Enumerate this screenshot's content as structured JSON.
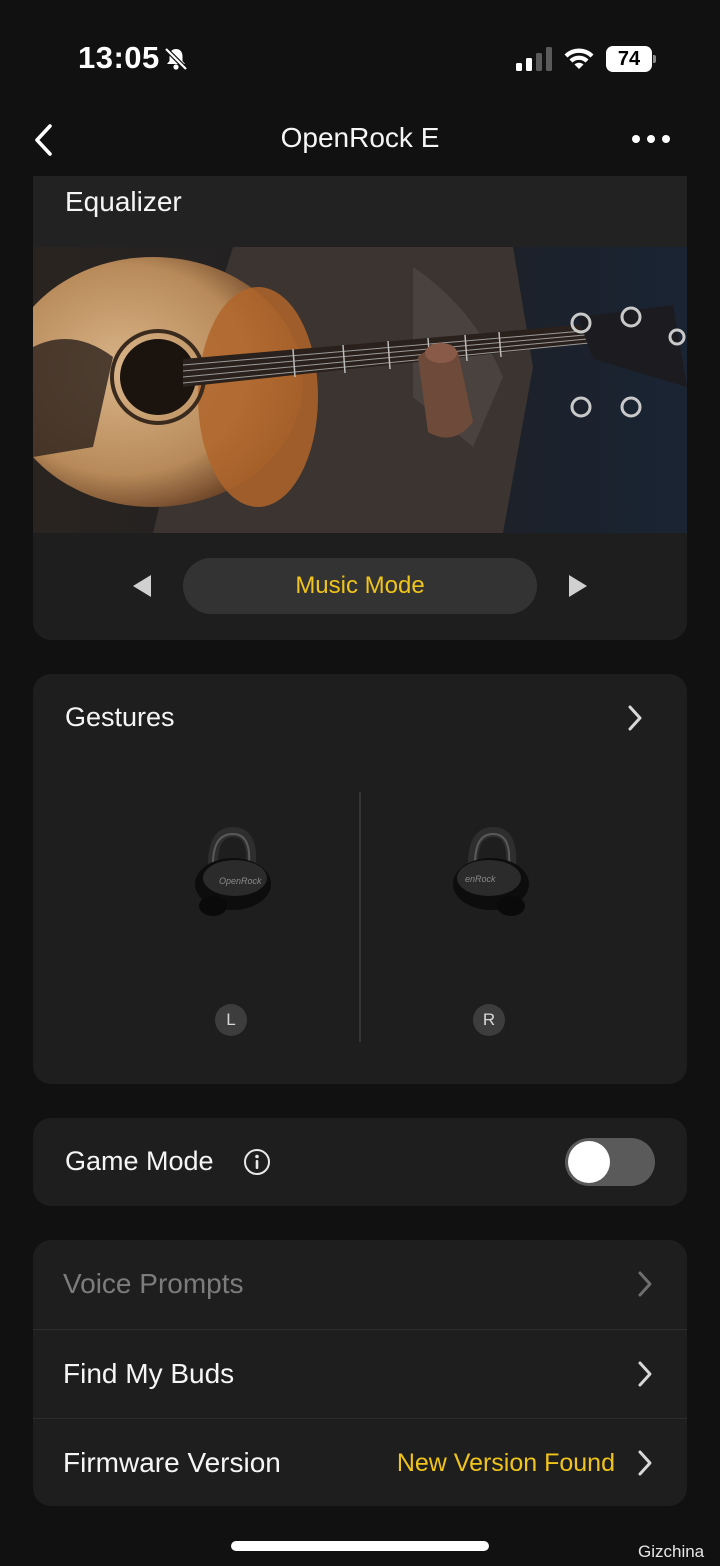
{
  "status_bar": {
    "time": "13:05",
    "battery": "74"
  },
  "nav": {
    "title": "OpenRock E"
  },
  "equalizer": {
    "title": "Equalizer",
    "mode": "Music Mode"
  },
  "gestures": {
    "title": "Gestures",
    "left_label": "L",
    "right_label": "R"
  },
  "game_mode": {
    "label": "Game Mode",
    "enabled": false
  },
  "settings_list": {
    "items": [
      {
        "label": "Voice Prompts",
        "value": "",
        "enabled": false
      },
      {
        "label": "Find My Buds",
        "value": "",
        "enabled": true
      },
      {
        "label": "Firmware Version",
        "value": "New Version Found",
        "enabled": true
      }
    ]
  },
  "watermark": "Gizchina",
  "colors": {
    "background": "#111111",
    "card": "#1e1e1e",
    "accent": "#f0c419",
    "toggle_off": "#5a5a5a"
  },
  "icons": [
    "bell-slash-icon",
    "cellular-signal-icon",
    "wifi-icon",
    "battery-icon",
    "back-chevron-icon",
    "more-dots-icon",
    "triangle-left-icon",
    "triangle-right-icon",
    "chevron-right-icon",
    "info-icon"
  ]
}
